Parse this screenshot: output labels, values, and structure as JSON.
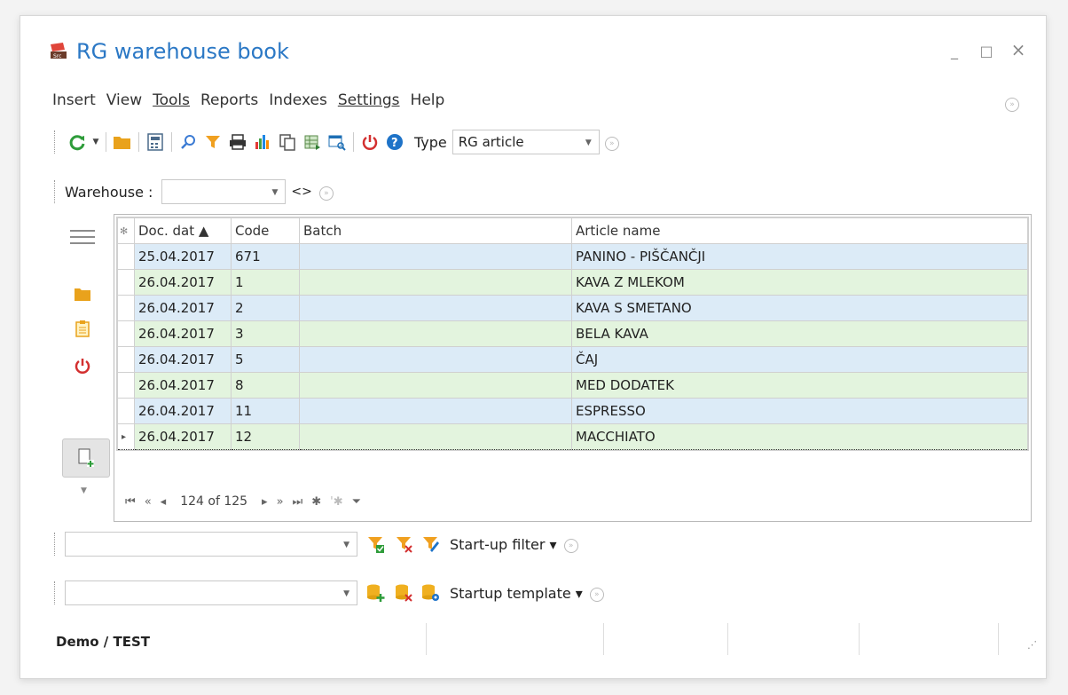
{
  "window": {
    "title": "RG warehouse book",
    "minimize": "_",
    "maximize": "□",
    "close": "×"
  },
  "menu": [
    {
      "label": "Insert",
      "u": false
    },
    {
      "label": "View",
      "u": false
    },
    {
      "label": "Tools",
      "u": true
    },
    {
      "label": "Reports",
      "u": false
    },
    {
      "label": "Indexes",
      "u": false
    },
    {
      "label": "Settings",
      "u": true
    },
    {
      "label": "Help",
      "u": false
    }
  ],
  "toolbar": {
    "type_label": "Type",
    "type_value": "RG article"
  },
  "warehouse": {
    "label": "Warehouse :",
    "value": "",
    "nav": "<>"
  },
  "grid": {
    "columns": [
      "Doc. dat ▲",
      "Code",
      "Batch",
      "Article name"
    ],
    "rows": [
      {
        "date": "25.04.2017",
        "code": "671",
        "batch": "",
        "name": "PANINO - PIŠČANČJI"
      },
      {
        "date": "26.04.2017",
        "code": "1",
        "batch": "",
        "name": "KAVA Z MLEKOM"
      },
      {
        "date": "26.04.2017",
        "code": "2",
        "batch": "",
        "name": "KAVA S SMETANO"
      },
      {
        "date": "26.04.2017",
        "code": "3",
        "batch": "",
        "name": "BELA KAVA"
      },
      {
        "date": "26.04.2017",
        "code": "5",
        "batch": "",
        "name": "ČAJ"
      },
      {
        "date": "26.04.2017",
        "code": "8",
        "batch": "",
        "name": "MED DODATEK"
      },
      {
        "date": "26.04.2017",
        "code": "11",
        "batch": "",
        "name": "ESPRESSO"
      },
      {
        "date": "26.04.2017",
        "code": "12",
        "batch": "",
        "name": "MACCHIATO"
      }
    ],
    "nav_count": "124 of 125"
  },
  "filter": {
    "label": "Start-up filter ▾"
  },
  "template": {
    "label": "Startup template ▾"
  },
  "status": {
    "text": "Demo / TEST"
  }
}
